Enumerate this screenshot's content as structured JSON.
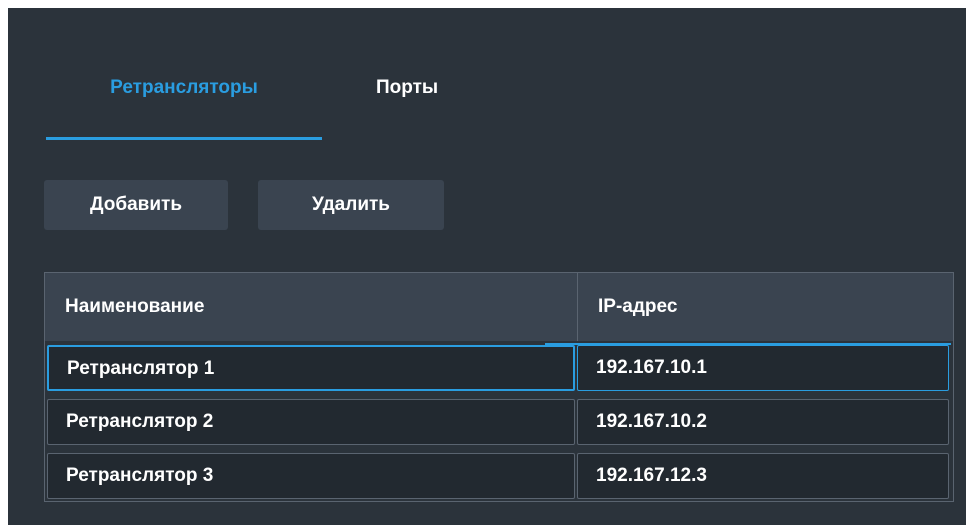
{
  "tabs": {
    "active_label": "Ретрансляторы",
    "inactive_label": "Порты"
  },
  "toolbar": {
    "add_label": "Добавить",
    "delete_label": "Удалить"
  },
  "table": {
    "columns": [
      "Наименование",
      "IP-адрес"
    ],
    "rows": [
      {
        "name": "Ретранслятор 1",
        "ip": "192.167.10.1",
        "selected": true
      },
      {
        "name": "Ретранслятор 2",
        "ip": "192.167.10.2",
        "selected": false
      },
      {
        "name": "Ретранслятор 3",
        "ip": "192.167.12.3",
        "selected": false
      }
    ]
  },
  "colors": {
    "accent": "#2a9de0",
    "panel_bg": "#2b333b",
    "header_bg": "#3a4450",
    "cell_bg": "#222930",
    "border": "#5a6470"
  }
}
